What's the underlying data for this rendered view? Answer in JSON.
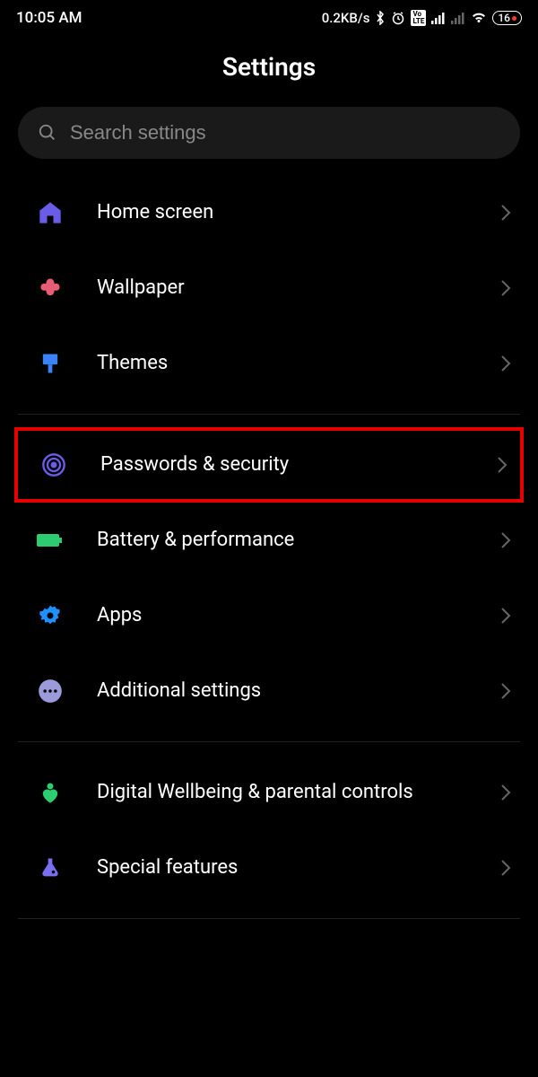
{
  "statusBar": {
    "time": "10:05 AM",
    "dataRate": "0.2KB/s",
    "batteryLevel": "16",
    "volte": "Vo LTE"
  },
  "header": {
    "title": "Settings"
  },
  "search": {
    "placeholder": "Search settings"
  },
  "items": {
    "homeScreen": {
      "label": "Home screen",
      "iconColor": "#6b5ce7"
    },
    "wallpaper": {
      "label": "Wallpaper",
      "iconColor": "#e85d75"
    },
    "themes": {
      "label": "Themes",
      "iconColor": "#3b82f6"
    },
    "passwordsSecurity": {
      "label": "Passwords & security",
      "iconColor": "#6b5ce7"
    },
    "batteryPerformance": {
      "label": "Battery & performance",
      "iconColor": "#2ecc71"
    },
    "apps": {
      "label": "Apps",
      "iconColor": "#1e90ff"
    },
    "additionalSettings": {
      "label": "Additional settings",
      "iconColor": "#9b9bdb"
    },
    "digitalWellbeing": {
      "label": "Digital Wellbeing & parental controls",
      "iconColor": "#2ecc71"
    },
    "specialFeatures": {
      "label": "Special features",
      "iconColor": "#7c6ef0"
    }
  }
}
